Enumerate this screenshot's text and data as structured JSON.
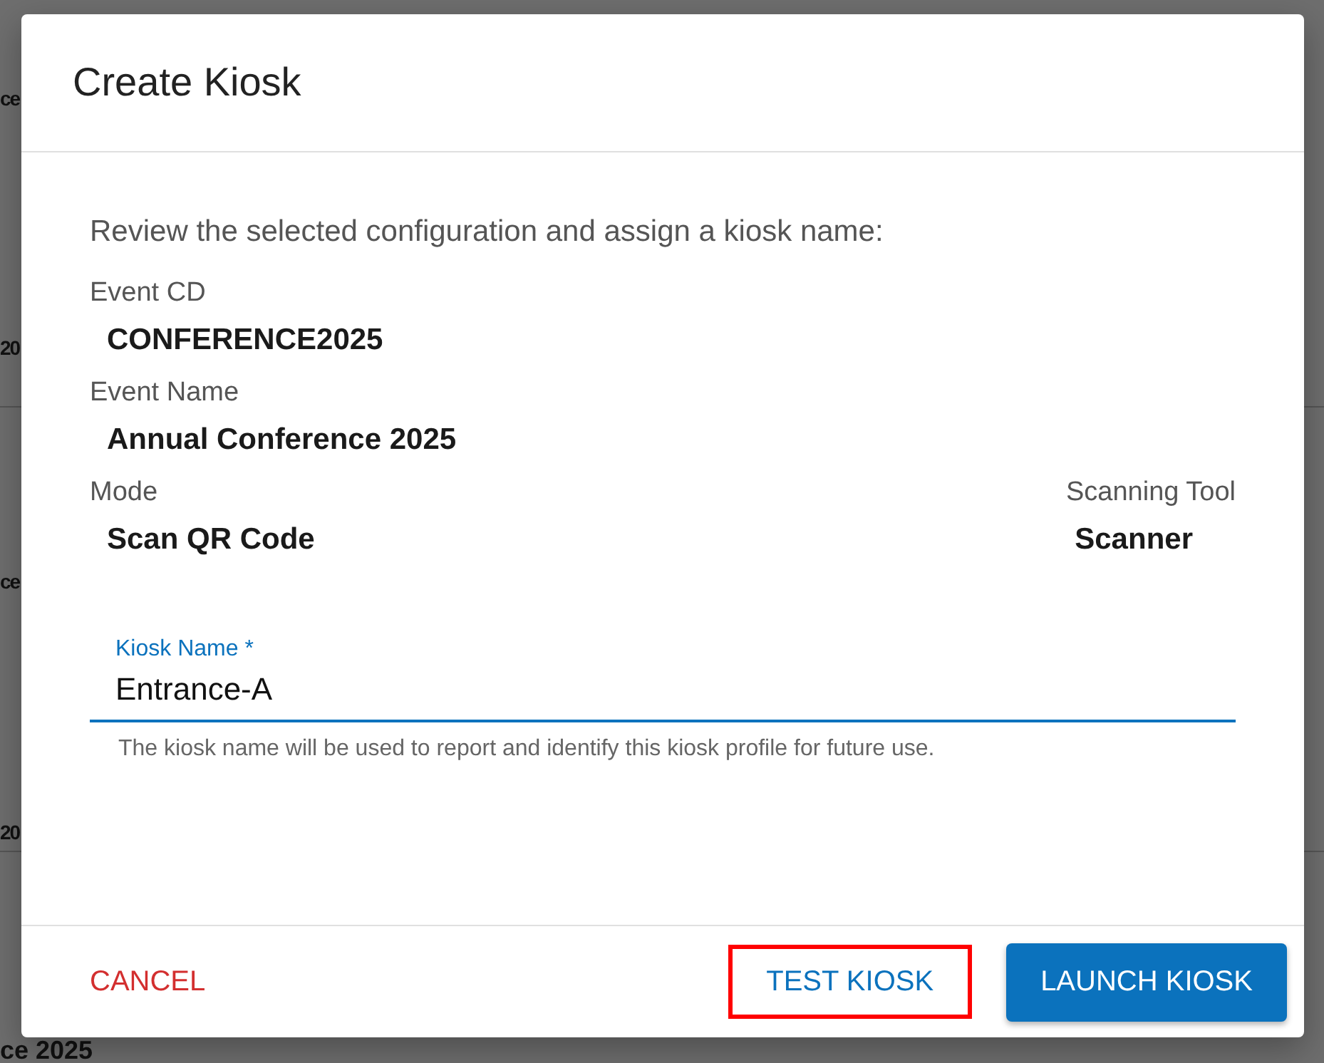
{
  "background": {
    "fragments": [
      "ce",
      "20",
      "ce",
      "20",
      "ce 2025"
    ]
  },
  "dialog": {
    "title": "Create Kiosk",
    "intro": "Review the selected configuration and assign a kiosk name:",
    "fields": [
      {
        "label": "Event CD",
        "value": "CONFERENCE2025"
      },
      {
        "label": "Event Name",
        "value": "Annual Conference 2025"
      }
    ],
    "pair": [
      {
        "label": "Mode",
        "value": "Scan QR Code"
      },
      {
        "label": "Scanning Tool",
        "value": "Scanner"
      }
    ],
    "kiosk_name": {
      "label": "Kiosk Name *",
      "value": "Entrance-A",
      "helper": "The kiosk name will be used to report and identify this kiosk profile for future use."
    },
    "buttons": [
      {
        "label": "CANCEL",
        "kind": "danger",
        "highlighted": false
      },
      {
        "label": "TEST KIOSK",
        "kind": "text",
        "highlighted": true
      },
      {
        "label": "LAUNCH KIOSK",
        "kind": "primary",
        "highlighted": false
      }
    ]
  }
}
